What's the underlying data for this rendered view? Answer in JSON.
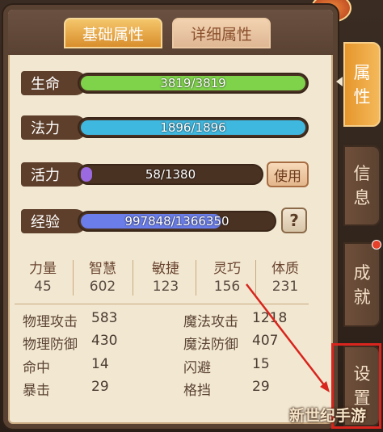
{
  "tabs": {
    "basic": "基础属性",
    "detail": "详细属性"
  },
  "bars": [
    {
      "label": "生命",
      "text": "3819/3819",
      "fill": 1.0,
      "color": "#7ed34a"
    },
    {
      "label": "法力",
      "text": "1896/1896",
      "fill": 1.0,
      "color": "#3fb8e0"
    },
    {
      "label": "活力",
      "text": "58/1380",
      "fill": 0.042,
      "color": "#9b6ae0"
    },
    {
      "label": "经验",
      "text": "997848/1366350",
      "fill": 0.73,
      "color": "#6a7de8"
    }
  ],
  "buttons": {
    "use": "使用",
    "help": "?"
  },
  "attributes": [
    {
      "name": "力量",
      "value": "45"
    },
    {
      "name": "智慧",
      "value": "602"
    },
    {
      "name": "敏捷",
      "value": "123"
    },
    {
      "name": "灵巧",
      "value": "156"
    },
    {
      "name": "体质",
      "value": "231"
    }
  ],
  "details_left": [
    {
      "name": "物理攻击",
      "value": "583"
    },
    {
      "name": "物理防御",
      "value": "430"
    },
    {
      "name": "命中",
      "value": "14"
    },
    {
      "name": "暴击",
      "value": "29"
    }
  ],
  "details_right": [
    {
      "name": "魔法攻击",
      "value": "1218"
    },
    {
      "name": "魔法防御",
      "value": "407"
    },
    {
      "name": "闪避",
      "value": "15"
    },
    {
      "name": "格挡",
      "value": "29"
    }
  ],
  "side_tabs": [
    {
      "label_top": "属",
      "label_bottom": "性"
    },
    {
      "label_top": "信",
      "label_bottom": "息"
    },
    {
      "label_top": "成",
      "label_bottom": "就"
    },
    {
      "label_top": "设",
      "label_bottom": "置"
    }
  ],
  "watermark": "新世纪手游"
}
